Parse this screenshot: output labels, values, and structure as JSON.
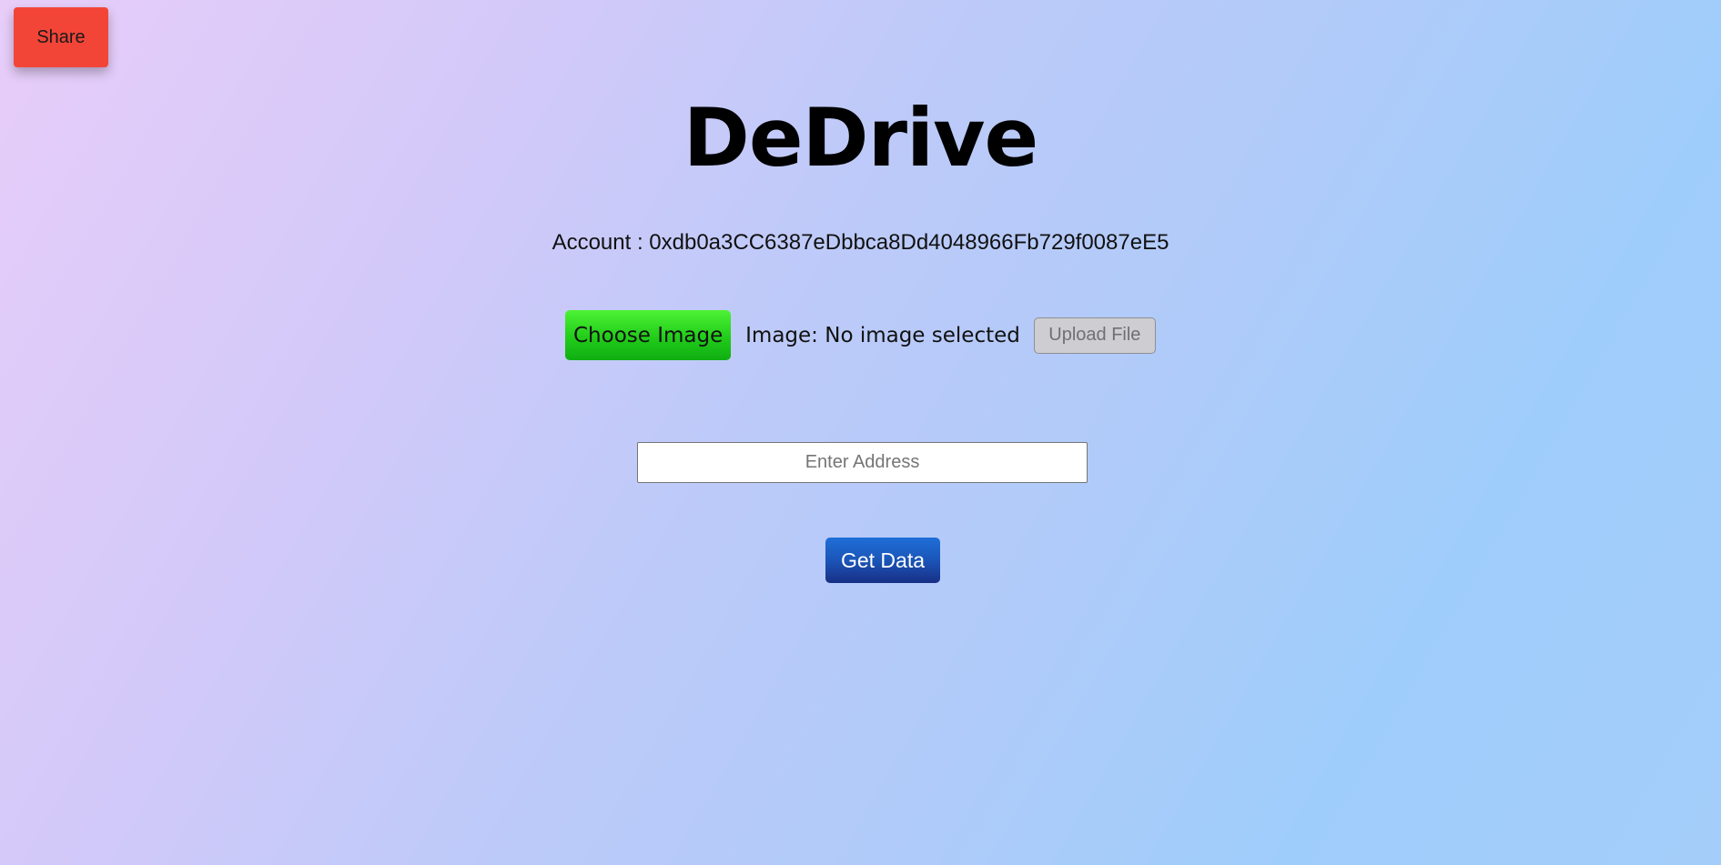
{
  "header": {
    "share_label": "Share",
    "title": "DeDrive"
  },
  "account": {
    "text": "Account : 0xdb0a3CC6387eDbbca8Dd4048966Fb729f0087eE5"
  },
  "upload": {
    "choose_label": "Choose Image",
    "image_status": "Image: No image selected",
    "upload_label": "Upload File"
  },
  "address": {
    "placeholder": "Enter Address",
    "value": ""
  },
  "actions": {
    "get_data_label": "Get Data"
  },
  "colors": {
    "share": "#f24538",
    "choose": "#22cc1a",
    "get_data": "#1b55b8",
    "upload_disabled": "#cdcdd2"
  }
}
